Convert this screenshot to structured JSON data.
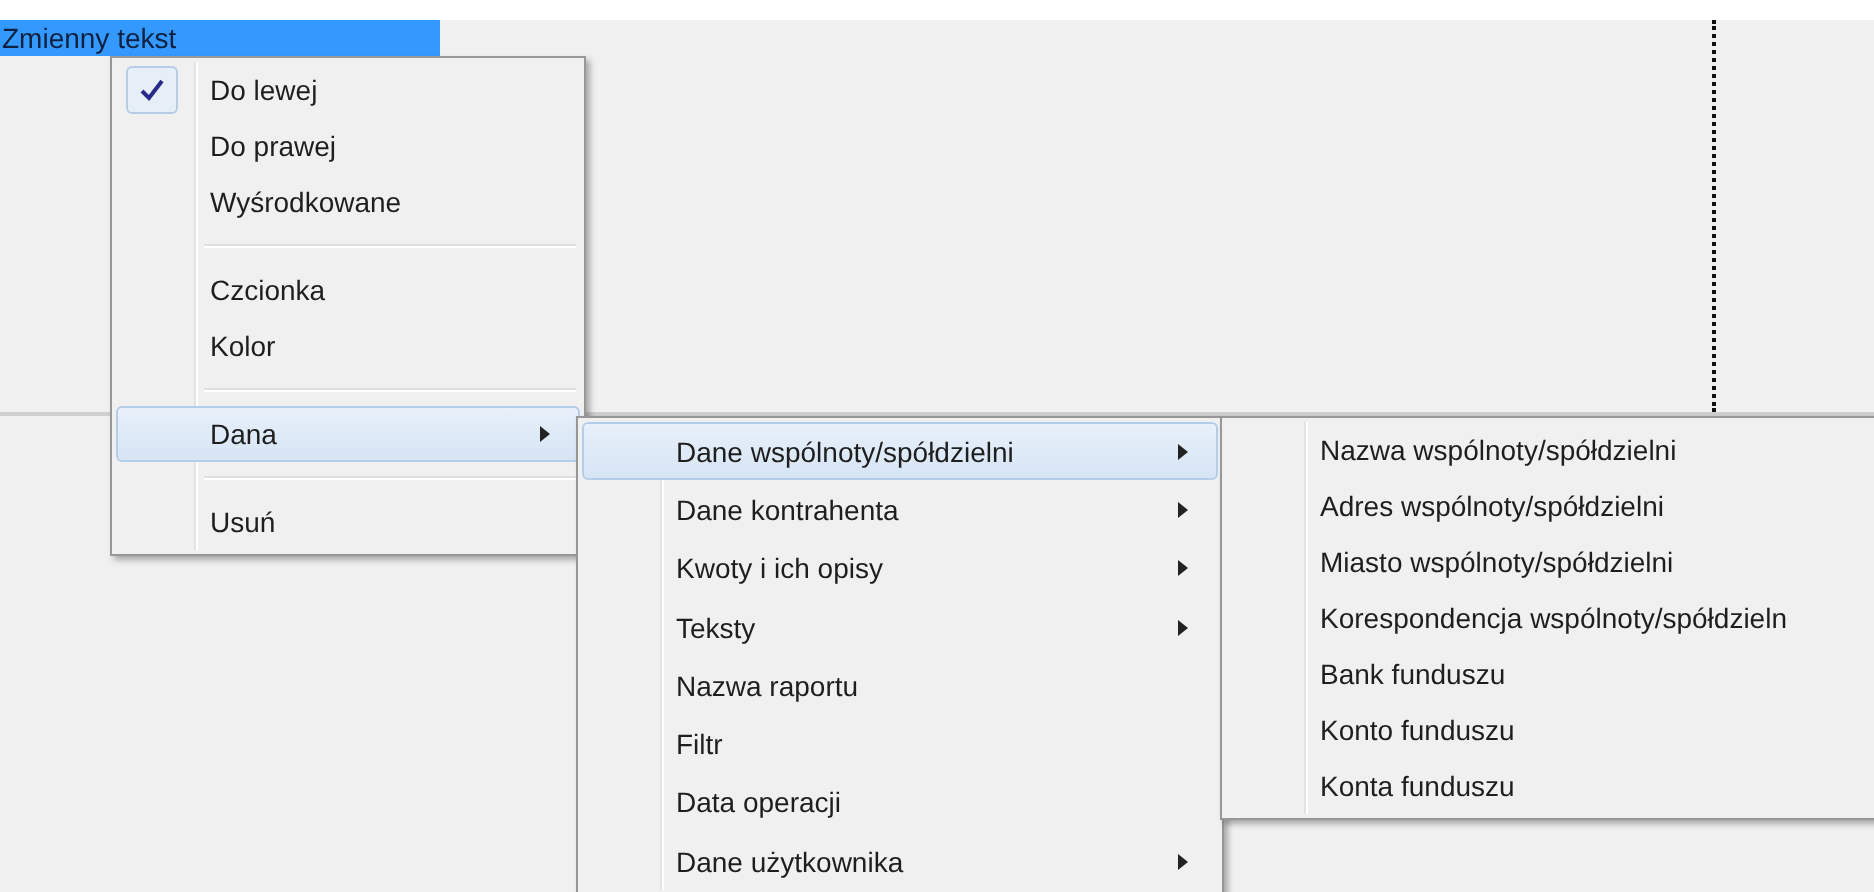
{
  "field_label": "Zmienny tekst",
  "menus": [
    {
      "items": [
        {
          "kind": "item",
          "label": "Do lewej",
          "checked": true,
          "selected": false,
          "submenu": false
        },
        {
          "kind": "item",
          "label": "Do prawej",
          "checked": false,
          "selected": false,
          "submenu": false
        },
        {
          "kind": "item",
          "label": "Wyśrodkowane",
          "checked": false,
          "selected": false,
          "submenu": false
        },
        {
          "kind": "separator"
        },
        {
          "kind": "item",
          "label": "Czcionka",
          "checked": false,
          "selected": false,
          "submenu": false
        },
        {
          "kind": "item",
          "label": "Kolor",
          "checked": false,
          "selected": false,
          "submenu": false
        },
        {
          "kind": "separator"
        },
        {
          "kind": "item",
          "label": "Dana",
          "checked": false,
          "selected": true,
          "submenu": true
        },
        {
          "kind": "separator"
        },
        {
          "kind": "item",
          "label": "Usuń",
          "checked": false,
          "selected": false,
          "submenu": false
        }
      ]
    },
    {
      "items": [
        {
          "kind": "item",
          "label": "Dane wspólnoty/spółdzielni",
          "checked": false,
          "selected": true,
          "submenu": true
        },
        {
          "kind": "item",
          "label": "Dane kontrahenta",
          "checked": false,
          "selected": false,
          "submenu": true
        },
        {
          "kind": "item",
          "label": "Kwoty i ich opisy",
          "checked": false,
          "selected": false,
          "submenu": true
        },
        {
          "kind": "item",
          "label": "Teksty",
          "checked": false,
          "selected": false,
          "submenu": true
        },
        {
          "kind": "item",
          "label": "Nazwa raportu",
          "checked": false,
          "selected": false,
          "submenu": false
        },
        {
          "kind": "item",
          "label": "Filtr",
          "checked": false,
          "selected": false,
          "submenu": false
        },
        {
          "kind": "item",
          "label": "Data operacji",
          "checked": false,
          "selected": false,
          "submenu": false
        },
        {
          "kind": "item",
          "label": "Dane użytkownika",
          "checked": false,
          "selected": false,
          "submenu": true
        }
      ]
    },
    {
      "items": [
        {
          "kind": "item",
          "label": "Nazwa wspólnoty/spółdzielni",
          "checked": false,
          "selected": false,
          "submenu": false
        },
        {
          "kind": "item",
          "label": "Adres wspólnoty/spółdzielni",
          "checked": false,
          "selected": false,
          "submenu": false
        },
        {
          "kind": "item",
          "label": "Miasto wspólnoty/spółdzielni",
          "checked": false,
          "selected": false,
          "submenu": false
        },
        {
          "kind": "item",
          "label": "Korespondencja wspólnoty/spółdzieln",
          "checked": false,
          "selected": false,
          "submenu": false
        },
        {
          "kind": "item",
          "label": "Bank funduszu",
          "checked": false,
          "selected": false,
          "submenu": false
        },
        {
          "kind": "item",
          "label": "Konto funduszu",
          "checked": false,
          "selected": false,
          "submenu": false
        },
        {
          "kind": "item",
          "label": "Konta funduszu",
          "checked": false,
          "selected": false,
          "submenu": false
        }
      ]
    }
  ]
}
